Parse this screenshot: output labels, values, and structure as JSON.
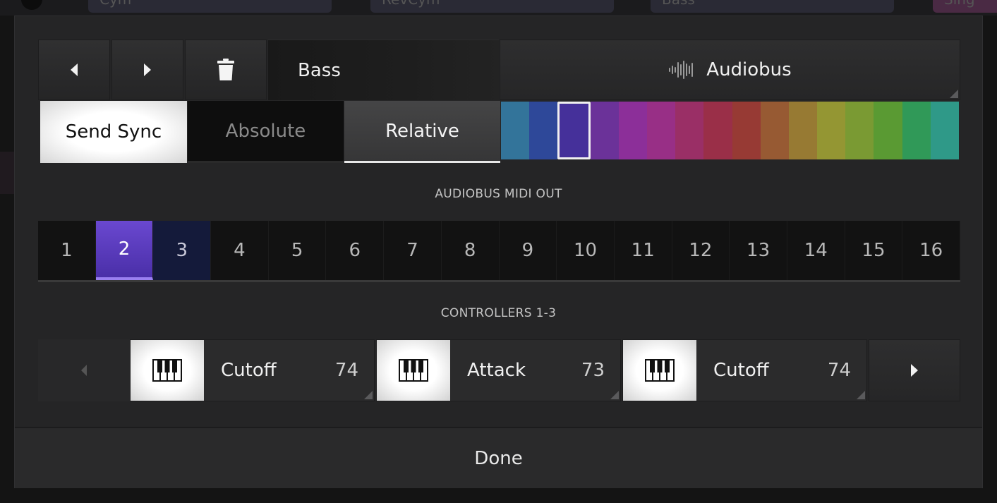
{
  "background_tracks": [
    "Cym",
    "RevCym",
    "Bass",
    "Sing"
  ],
  "header": {
    "track_name": "Bass",
    "audiobus_label": "Audiobus"
  },
  "modes": {
    "send_sync": "Send Sync",
    "absolute": "Absolute",
    "relative": "Relative"
  },
  "colors": {
    "swatches": [
      "#33749a",
      "#2e4899",
      "#45309a",
      "#6b3299",
      "#8c2f99",
      "#982f86",
      "#9a2f66",
      "#9a2f48",
      "#973a34",
      "#975a33",
      "#977a33",
      "#949633",
      "#7a9a33",
      "#5a9a33",
      "#309958",
      "#2f9988"
    ],
    "selected_index": 2,
    "channel_active": "#5a3dc0",
    "channel_secondary": "#141a3a"
  },
  "midi_out": {
    "label": "AUDIOBUS MIDI OUT",
    "channels": [
      "1",
      "2",
      "3",
      "4",
      "5",
      "6",
      "7",
      "8",
      "9",
      "10",
      "11",
      "12",
      "13",
      "14",
      "15",
      "16"
    ],
    "active_channel": "2",
    "secondary_channel": "3"
  },
  "controllers": {
    "label": "CONTROLLERS 1-3",
    "items": [
      {
        "name": "Cutoff",
        "number": "74"
      },
      {
        "name": "Attack",
        "number": "73"
      },
      {
        "name": "Cutoff",
        "number": "74"
      }
    ]
  },
  "footer": {
    "done_label": "Done"
  }
}
